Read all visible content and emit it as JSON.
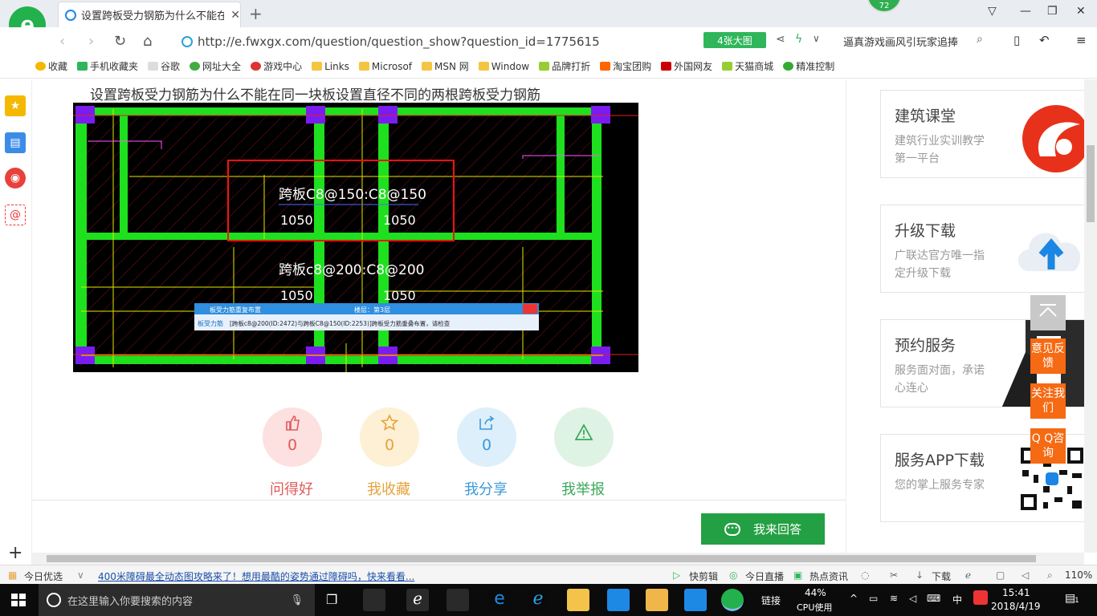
{
  "browser": {
    "tab_title": "设置跨板受力钢筋为什么不能在同一块板设置直径不同的两根跨板受力钢筋",
    "badge_count": "72",
    "url": "http://e.fwxgx.com/question/question_show?question_id=1775615",
    "big_image_label": "4张大图",
    "search_text": "逼真游戏画风引玩家追捧"
  },
  "bookmarks": [
    "收藏",
    "手机收藏夹",
    "谷歌",
    "网址大全",
    "游戏中心",
    "Links",
    "Microsof",
    "MSN 网",
    "Window",
    "品牌打折",
    "淘宝团购",
    "外国网友",
    "天猫商城",
    "精准控制"
  ],
  "page": {
    "title": "设置跨板受力钢筋为什么不能在同一块板设置直径不同的两根跨板受力钢筋"
  },
  "cad": {
    "label1": "跨板C8@150:C8@150",
    "dim_left": "1050",
    "dim_right": "1050",
    "label2": "跨板c8@200:C8@200",
    "dim2_left": "1050",
    "dim2_right": "1050",
    "dialog_title": "板受力筋重复布置",
    "dialog_floor": "楼层：第3层",
    "dialog_tab": "板受力筋",
    "dialog_msg": "[跨板c8@200(ID:2472)与跨板C8@150(ID:2253)]跨板受力筋重叠布置，请检查"
  },
  "actions": [
    {
      "count": "0",
      "label": "问得好",
      "color": "#e05a5a",
      "bg": "#fde0e0"
    },
    {
      "count": "0",
      "label": "我收藏",
      "color": "#e6a23c",
      "bg": "#fdf0d5"
    },
    {
      "count": "0",
      "label": "我分享",
      "color": "#3a9ad9",
      "bg": "#dceffb"
    },
    {
      "count": "0",
      "label": "我举报",
      "color": "#3aa85a",
      "bg": "#dff3e4"
    }
  ],
  "answer_button": "我来回答",
  "cards": [
    {
      "title": "建筑课堂",
      "sub": "建筑行业实训教学第一平台"
    },
    {
      "title": "升级下载",
      "sub": "广联达官方唯一指定升级下载"
    },
    {
      "title": "预约服务",
      "sub": "服务面对面，承诺心连心"
    },
    {
      "title": "服务APP下载",
      "sub": "您的掌上服务专家"
    }
  ],
  "float_buttons": [
    "意见反馈",
    "关注我们",
    "Q Q咨询"
  ],
  "statusbar": {
    "today": "今日优选",
    "news": "400米障碍最全动态图攻略来了！想用最酷的姿势通过障碍吗，快来看看...",
    "clip": "快剪辑",
    "live": "今日直播",
    "hot": "热点资讯",
    "download": "下载",
    "zoom": "110%"
  },
  "taskbar": {
    "search_placeholder": "在这里输入你要搜索的内容",
    "link": "链接",
    "cpu": "44%",
    "cpu_label": "CPU使用",
    "ime": "中",
    "time": "15:41",
    "date": "2018/4/19",
    "notif": "1"
  }
}
